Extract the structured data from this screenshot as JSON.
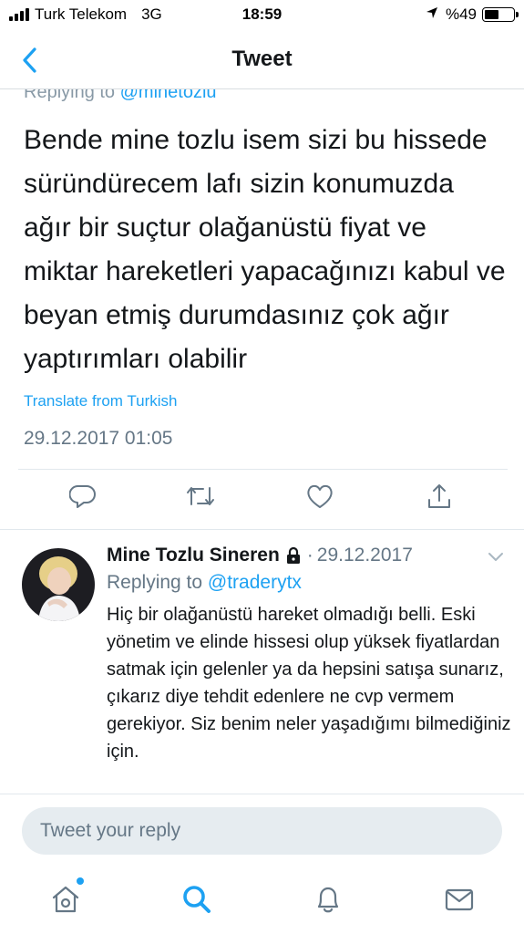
{
  "status_bar": {
    "carrier": "Turk Telekom",
    "network": "3G",
    "time": "18:59",
    "battery": "%49",
    "battery_level": 0.49
  },
  "nav": {
    "title": "Tweet"
  },
  "tweet": {
    "replying_prefix": "Replying to",
    "replying_handle": "@minetozlu",
    "text": "Bende mine tozlu isem sizi bu hissede süründürecem lafı sizin konumuzda ağır bir suçtur olağanüstü fiyat ve miktar hareketleri yapacağınızı kabul ve beyan etmiş durumdasınız çok ağır yaptırımları olabilir",
    "translate": "Translate from Turkish",
    "timestamp": "29.12.2017 01:05"
  },
  "reply": {
    "name": "Mine Tozlu Sineren",
    "separator": "·",
    "date": "29.12.2017",
    "replying_prefix": "Replying to",
    "replying_handle": "@traderytx",
    "text": "Hiç bir olağanüstü hareket olmadığı belli. Eski yönetim ve elinde hissesi olup yüksek fiyatlardan satmak için gelenler ya da hepsini satışa sunarız, çıkarız diye tehdit edenlere ne cvp vermem gerekiyor. Siz benim neler yaşadığımı bilmediğiniz için."
  },
  "composer": {
    "placeholder": "Tweet your reply"
  },
  "colors": {
    "accent": "#1da1f2",
    "secondary_text": "#657786",
    "icon_gray": "#657786"
  },
  "icons": {
    "back": "chevron-left-icon",
    "reply": "reply-icon",
    "retweet": "retweet-icon",
    "like": "heart-icon",
    "share": "share-icon",
    "lock": "lock-icon",
    "more": "chevron-down-icon",
    "home": "home-icon",
    "search": "search-icon",
    "notifications": "bell-icon",
    "messages": "mail-icon"
  }
}
